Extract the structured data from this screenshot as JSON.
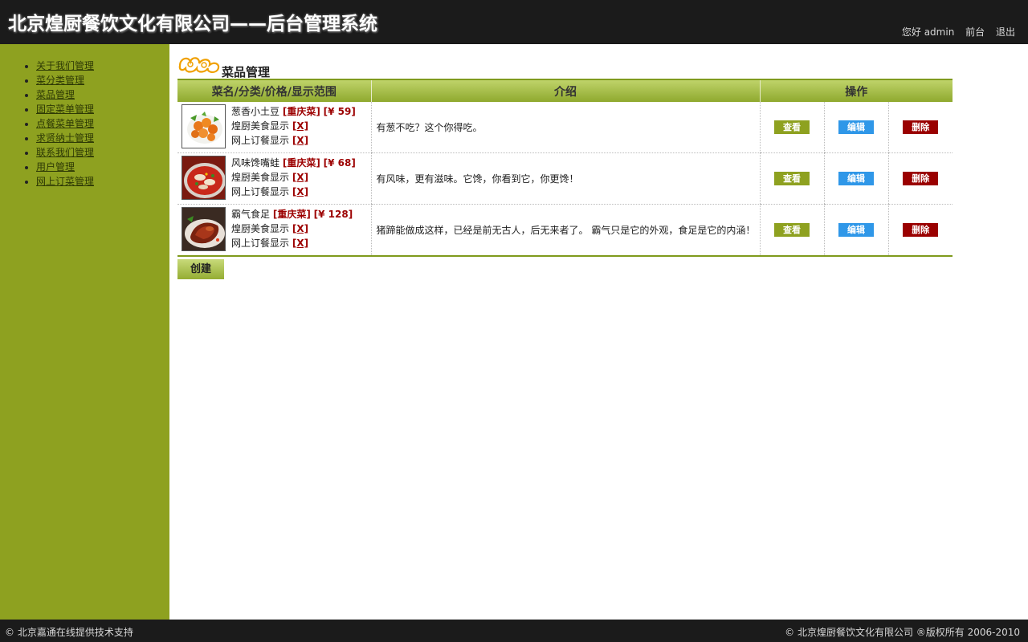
{
  "header": {
    "title": "北京煌厨餐饮文化有限公司——后台管理系统",
    "greeting": "您好 admin",
    "links": [
      "前台",
      "退出"
    ]
  },
  "sidebar": {
    "items": [
      {
        "label": "关于我们管理"
      },
      {
        "label": "菜分类管理"
      },
      {
        "label": "菜品管理"
      },
      {
        "label": "固定菜单管理"
      },
      {
        "label": "点餐菜单管理"
      },
      {
        "label": "求贤纳士管理"
      },
      {
        "label": "联系我们管理"
      },
      {
        "label": "用户管理"
      },
      {
        "label": "网上订菜管理"
      }
    ]
  },
  "main": {
    "title": "菜品管理",
    "columns": [
      "菜名/分类/价格/显示范围",
      "介绍",
      "操作"
    ],
    "rows": [
      {
        "name": "葱香小土豆",
        "category": "[重庆菜]",
        "price": "[¥ 59]",
        "show_food_label": "煌厨美食显示",
        "show_food_flag": "[X]",
        "show_order_label": "网上订餐显示",
        "show_order_flag": "[X]",
        "intro": "有葱不吃？这个你得吃。"
      },
      {
        "name": "风味馋嘴蛙",
        "category": "[重庆菜]",
        "price": "[¥ 68]",
        "show_food_label": "煌厨美食显示",
        "show_food_flag": "[X]",
        "show_order_label": "网上订餐显示",
        "show_order_flag": "[X]",
        "intro": "有风味，更有滋味。它馋，你看到它，你更馋！"
      },
      {
        "name": "霸气食足",
        "category": "[重庆菜]",
        "price": "[¥ 128]",
        "show_food_label": "煌厨美食显示",
        "show_food_flag": "[X]",
        "show_order_label": "网上订餐显示",
        "show_order_flag": "[X]",
        "intro": "猪蹄能做成这样，已经是前无古人，后无来者了。 霸气只是它的外观，食足是它的内涵！"
      }
    ],
    "actions": {
      "view": "查看",
      "edit": "编辑",
      "delete": "删除"
    },
    "create_label": "创建"
  },
  "footer": {
    "left": "© 北京嘉通在线提供技术支持",
    "right": "© 北京煌厨餐饮文化有限公司 ®版权所有 2006-2010"
  },
  "colors": {
    "sidebar_bg": "#8ea120",
    "header_bg": "#1b1b1b",
    "view_btn": "#8ea120",
    "edit_btn": "#2f97e8",
    "delete_btn": "#9a0000",
    "accent_red": "#9c0000"
  }
}
